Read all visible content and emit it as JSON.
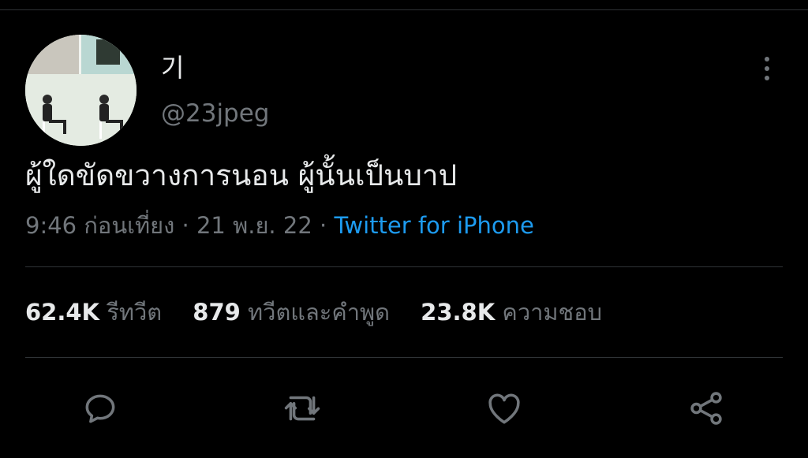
{
  "tweet": {
    "display_name": "기",
    "handle": "@23jpeg",
    "text": "ผู้ใดขัดขวางการนอน ผู้นั้นเป็นบาป",
    "time": "9:46 ก่อนเที่ยง",
    "separator": "·",
    "date": "21 พ.ย. 22",
    "source": "Twitter for iPhone"
  },
  "stats": {
    "retweets_count": "62.4K",
    "retweets_label": "รีทวีต",
    "quotes_count": "879",
    "quotes_label": "ทวีตและคำพูด",
    "likes_count": "23.8K",
    "likes_label": "ความชอบ"
  },
  "icons": {
    "more": "more-vertical-icon",
    "reply": "reply-icon",
    "retweet": "retweet-icon",
    "like": "heart-icon",
    "share": "share-icon"
  },
  "colors": {
    "background": "#000000",
    "text_primary": "#e7e9ea",
    "text_secondary": "#71767b",
    "link": "#1d9bf0",
    "divider": "#2f3336"
  }
}
